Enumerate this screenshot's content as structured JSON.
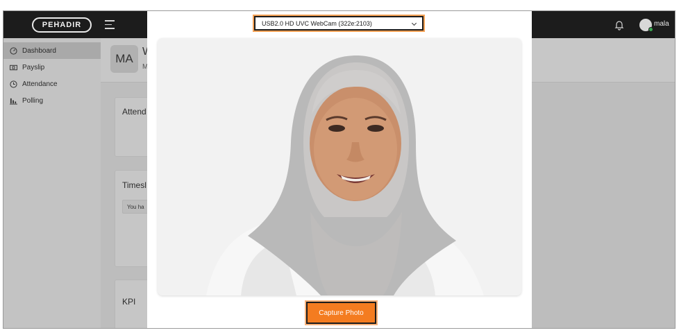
{
  "header": {
    "logo_text": "PEHADIR",
    "user_name": "mala"
  },
  "sidebar": {
    "items": [
      {
        "label": "Dashboard",
        "icon": "gauge-icon",
        "active": true
      },
      {
        "label": "Payslip",
        "icon": "payslip-icon",
        "active": false
      },
      {
        "label": "Attendance",
        "icon": "clock-icon",
        "active": false
      },
      {
        "label": "Polling",
        "icon": "bar-chart-icon",
        "active": false
      }
    ]
  },
  "main": {
    "initials": "MA",
    "welcome_partial": "W",
    "subtitle_partial": "M",
    "cards": [
      {
        "title": "Attend"
      },
      {
        "title": "Timesl",
        "note": "You ha"
      },
      {
        "title": "KPI"
      }
    ]
  },
  "modal": {
    "camera_select_value": "USB2.0 HD UVC WebCam (322e:2103)",
    "capture_button_label": "Capture Photo"
  },
  "colors": {
    "accent": "#f47c20",
    "topbar": "#1c1c1c",
    "status_online": "#3aa852"
  }
}
